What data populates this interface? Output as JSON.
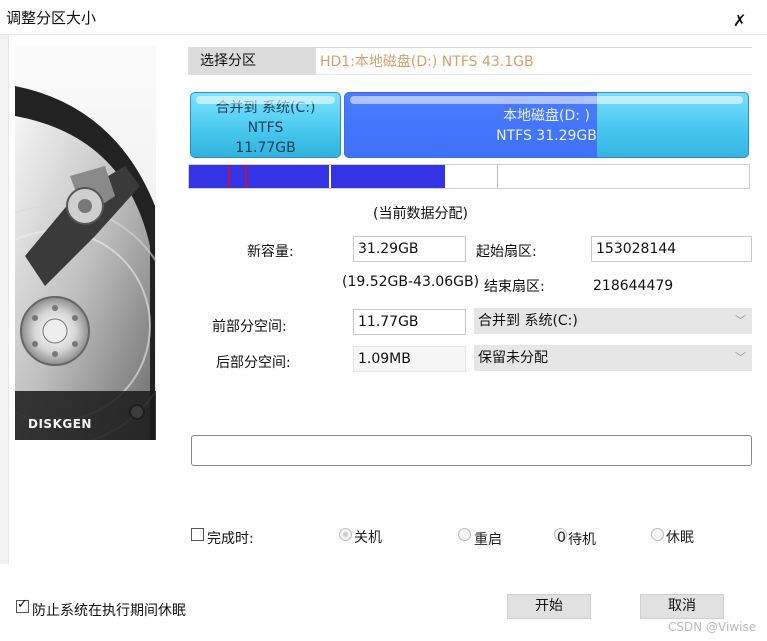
{
  "window": {
    "title": "调整分区大小",
    "close_glyph": "✗"
  },
  "disk_image": {
    "brand_text": "DISKGEN"
  },
  "select_partition": {
    "label": "选择分区",
    "value": "HD1:本地磁盘(D:) NTFS 43.1GB"
  },
  "partitions": [
    {
      "name": "合并到 系统(C:)",
      "fs": "NTFS",
      "size": "11.77GB"
    },
    {
      "name": "本地磁盘(D: )",
      "fs": "NTFS 31.29GB",
      "size": ""
    }
  ],
  "layout_map": {
    "used_color": "#3434e6",
    "marker_color": "#c1123b"
  },
  "allocation": {
    "section_title": "(当前数据分配)",
    "new_capacity_label": "新容量:",
    "new_capacity_value": "31.29GB",
    "range_hint": "(19.52GB-43.06GB)",
    "start_sector_label": "起始扇区:",
    "start_sector_value": "153028144",
    "end_sector_label": "结束扇区:",
    "end_sector_value": "218644479",
    "front_space_label": "前部分空间:",
    "front_space_value": "11.77GB",
    "front_space_option": "合并到 系统(C:)",
    "back_space_label": "后部分空间:",
    "back_space_value": "1.09MB",
    "back_space_option": "保留未分配"
  },
  "on_complete": {
    "label": "完成时:",
    "options": [
      "关机",
      "重启",
      "待机",
      "休眠"
    ],
    "standby_prefix": "0"
  },
  "prevent_sleep": {
    "label": "防止系统在执行期间休眠",
    "checked": true
  },
  "buttons": {
    "start": "开始",
    "cancel": "取消"
  },
  "watermark": "CSDN @Viwise"
}
